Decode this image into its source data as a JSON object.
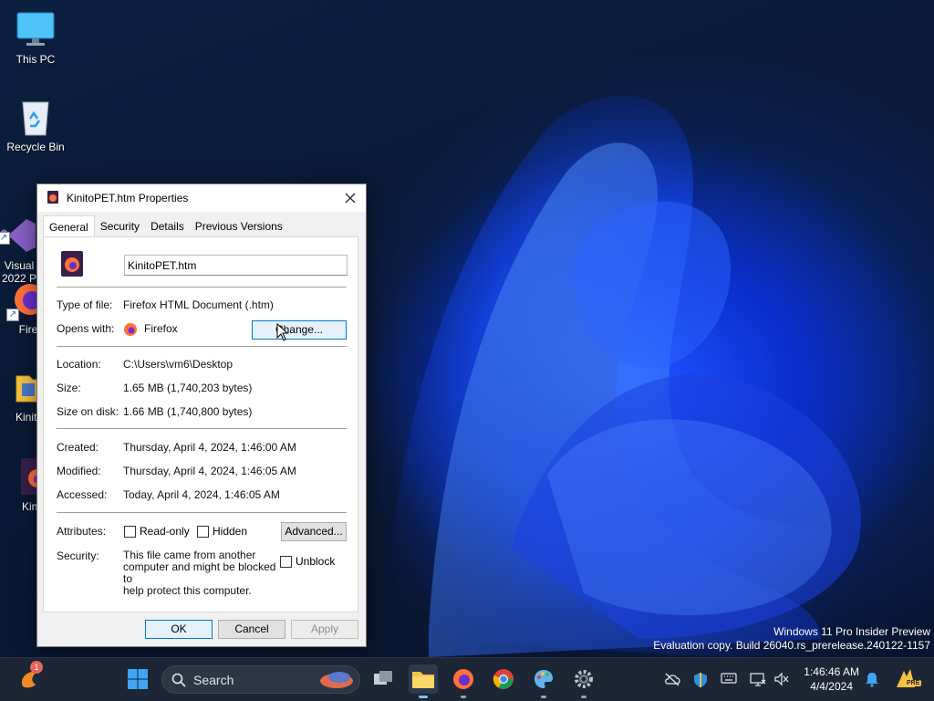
{
  "desktop": {
    "icons": [
      {
        "label": "This PC"
      },
      {
        "label": "Recycle Bin"
      },
      {
        "label": "Visual\n2022 P"
      },
      {
        "label": "Fire"
      },
      {
        "label": "KinitoP"
      },
      {
        "label": "Kinito"
      }
    ]
  },
  "dialog": {
    "title": "KinitoPET.htm Properties",
    "tabs": [
      {
        "label": "General",
        "active": true
      },
      {
        "label": "Security"
      },
      {
        "label": "Details"
      },
      {
        "label": "Previous Versions"
      }
    ],
    "filename": "KinitoPET.htm",
    "type_label": "Type of file:",
    "type_value": "Firefox HTML Document (.htm)",
    "opens_label": "Opens with:",
    "opens_value": "Firefox",
    "change_button": "Change...",
    "location_label": "Location:",
    "location_value": "C:\\Users\\vm6\\Desktop",
    "size_label": "Size:",
    "size_value": "1.65 MB (1,740,203 bytes)",
    "size_on_disk_label": "Size on disk:",
    "size_on_disk_value": "1.66 MB (1,740,800 bytes)",
    "created_label": "Created:",
    "created_value": "Thursday, April 4, 2024, 1:46:00 AM",
    "modified_label": "Modified:",
    "modified_value": "Thursday, April 4, 2024, 1:46:05 AM",
    "accessed_label": "Accessed:",
    "accessed_value": "Today, April 4, 2024, 1:46:05 AM",
    "attributes_label": "Attributes:",
    "readonly_label": "Read-only",
    "hidden_label": "Hidden",
    "advanced_button": "Advanced...",
    "security_label": "Security:",
    "security_text": [
      "This file came from another",
      "computer and might be blocked to",
      "help protect this computer."
    ],
    "unblock_label": "Unblock",
    "ok_button": "OK",
    "cancel_button": "Cancel",
    "apply_button": "Apply"
  },
  "watermark": {
    "line1": "Windows 11 Pro Insider Preview",
    "line2": "Evaluation copy. Build 26040.rs_prerelease.240122-1157"
  },
  "taskbar": {
    "search_placeholder": "Search",
    "notification_count": "1",
    "time": "1:46:46 AM",
    "date": "4/4/2024",
    "pre_badge": "PRE"
  },
  "colors": {
    "accent": "#0078d7",
    "taskbar_bg": "#1c2635",
    "dialog_bg": "#f0f0f0"
  }
}
